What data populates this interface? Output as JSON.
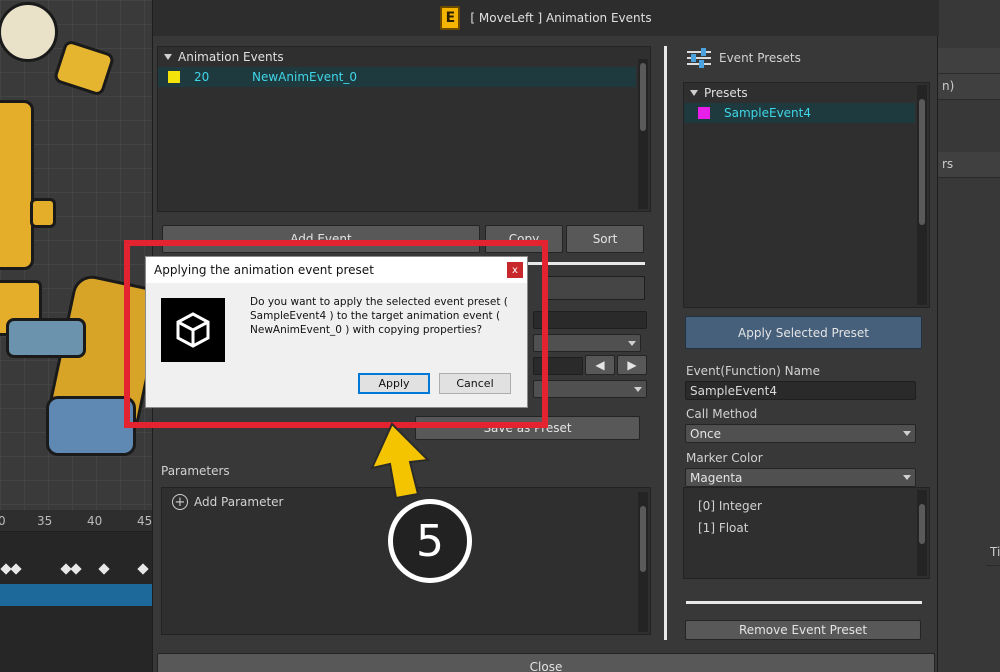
{
  "window": {
    "title": "[ MoveLeft ] Animation Events",
    "logo_letter": "E"
  },
  "events_panel": {
    "header": "Animation Events",
    "rows": [
      {
        "frame": "20",
        "name": "NewAnimEvent_0",
        "color": "#f2e40a"
      }
    ]
  },
  "event_buttons": {
    "add": "Add Event",
    "copy": "Copy",
    "sort": "Sort",
    "save_as_preset": "Save as Preset"
  },
  "parameters": {
    "label": "Parameters",
    "add": "Add Parameter"
  },
  "presets_panel": {
    "header": "Event Presets",
    "list_header": "Presets",
    "rows": [
      {
        "name": "SampleEvent4",
        "color": "#e81fe8"
      }
    ],
    "apply_button": "Apply Selected Preset",
    "function_name_label": "Event(Function) Name",
    "function_name_value": "SampleEvent4",
    "call_method_label": "Call Method",
    "call_method_value": "Once",
    "marker_color_label": "Marker Color",
    "marker_color_value": "Magenta",
    "params": [
      "[0] Integer",
      "[1] Float"
    ],
    "remove_button": "Remove Event Preset"
  },
  "close_button": "Close",
  "dialog": {
    "title": "Applying the animation event preset",
    "close": "x",
    "message": "Do you want to apply the selected event preset ( SampleEvent4 ) to the target animation event ( NewAnimEvent_0 ) with copying properties?",
    "apply": "Apply",
    "cancel": "Cancel"
  },
  "annotation": {
    "step": "5",
    "highlight_color": "#e3232f",
    "arrow_color": "#f5c400"
  },
  "timeline": {
    "ticks": [
      "0",
      "35",
      "40",
      "45"
    ]
  },
  "right_strip": {
    "rows": [
      "n)",
      "rs"
    ],
    "side_label": "Ti"
  }
}
